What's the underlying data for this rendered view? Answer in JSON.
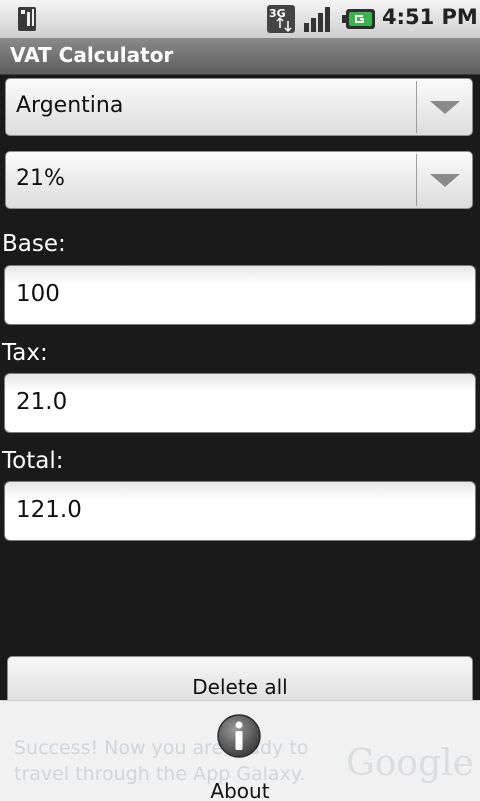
{
  "status_bar": {
    "time": "4:51 PM",
    "icons": [
      "sim-icon",
      "3g-icon",
      "signal-icon",
      "battery-icon"
    ]
  },
  "app": {
    "title": "VAT Calculator"
  },
  "form": {
    "country": {
      "selected": "Argentina"
    },
    "rate": {
      "selected": "21%"
    },
    "base": {
      "label": "Base:",
      "value": "100"
    },
    "tax": {
      "label": "Tax:",
      "value": "21.0"
    },
    "total": {
      "label": "Total:",
      "value": "121.0"
    },
    "delete_label": "Delete all"
  },
  "options_menu": {
    "items": [
      {
        "label": "About",
        "icon": "info-icon"
      }
    ]
  },
  "ad_banner": {
    "text": "Success! Now you are ready to travel through the App Galaxy.",
    "logo": "Google"
  },
  "colors": {
    "background": "#1a1a1a",
    "title_bar": "#6e6e6e",
    "status_bar": "#e0e0e0",
    "battery_accent": "#3ab54a"
  }
}
